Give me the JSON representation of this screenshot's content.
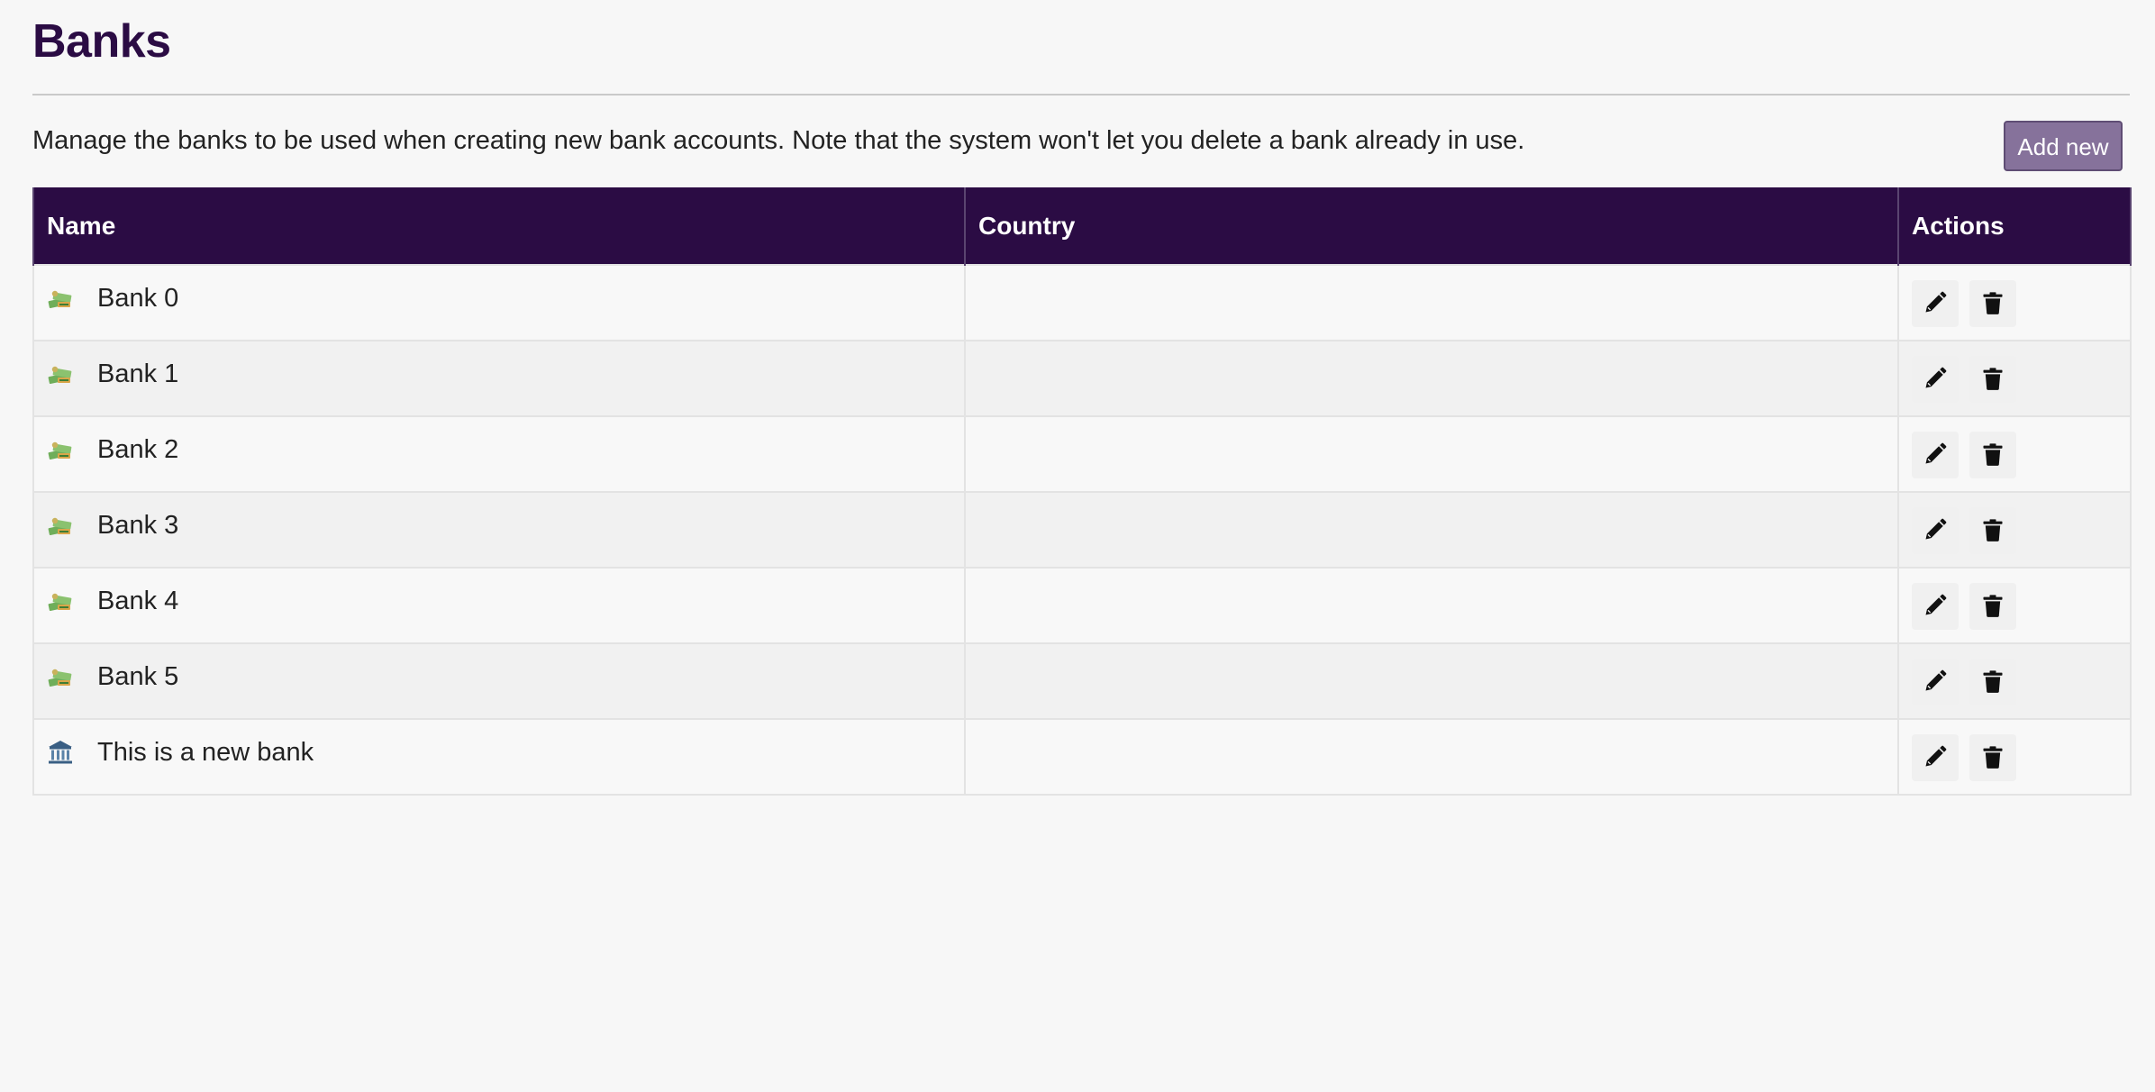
{
  "page": {
    "title": "Banks",
    "description": "Manage the banks to be used when creating new bank accounts. Note that the system won't let you delete a bank already in use.",
    "add_new_label": "Add new"
  },
  "table": {
    "columns": [
      "Name",
      "Country",
      "Actions"
    ],
    "rows": [
      {
        "name": "Bank 0",
        "country": "",
        "icon": "money-icon"
      },
      {
        "name": "Bank 1",
        "country": "",
        "icon": "money-icon"
      },
      {
        "name": "Bank 2",
        "country": "",
        "icon": "money-icon"
      },
      {
        "name": "Bank 3",
        "country": "",
        "icon": "money-icon"
      },
      {
        "name": "Bank 4",
        "country": "",
        "icon": "money-icon"
      },
      {
        "name": "Bank 5",
        "country": "",
        "icon": "money-icon"
      },
      {
        "name": "This is a new bank",
        "country": "",
        "icon": "bank-building-icon"
      }
    ]
  },
  "colors": {
    "brand": "#2b0c44",
    "button": "#86729b"
  }
}
